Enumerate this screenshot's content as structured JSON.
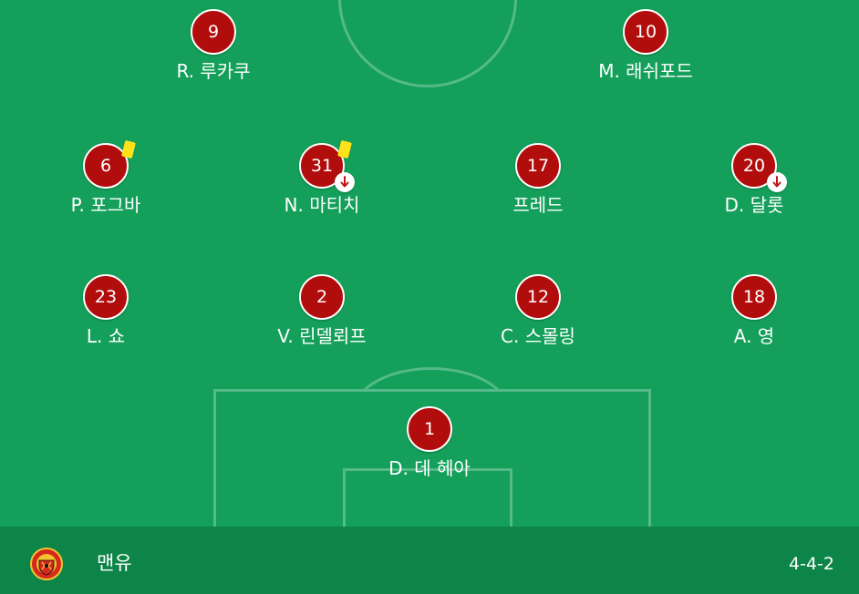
{
  "team": {
    "name": "맨유",
    "formation": "4-4-2",
    "crest_icon": "manchester-united-crest",
    "shirt_color": "#b20d0d",
    "pitch_color": "#14a05a",
    "footer_color": "#0e8548"
  },
  "players": [
    {
      "number": "9",
      "name": "R. 루카쿠",
      "yellow_card": false,
      "substituted": false
    },
    {
      "number": "10",
      "name": "M. 래쉬포드",
      "yellow_card": false,
      "substituted": false
    },
    {
      "number": "6",
      "name": "P. 포그바",
      "yellow_card": true,
      "substituted": false
    },
    {
      "number": "31",
      "name": "N. 마티치",
      "yellow_card": true,
      "substituted": true
    },
    {
      "number": "17",
      "name": "프레드",
      "yellow_card": false,
      "substituted": false
    },
    {
      "number": "20",
      "name": "D. 달롯",
      "yellow_card": false,
      "substituted": true
    },
    {
      "number": "23",
      "name": "L. 쇼",
      "yellow_card": false,
      "substituted": false
    },
    {
      "number": "2",
      "name": "V. 린델뢰프",
      "yellow_card": false,
      "substituted": false
    },
    {
      "number": "12",
      "name": "C. 스몰링",
      "yellow_card": false,
      "substituted": false
    },
    {
      "number": "18",
      "name": "A. 영",
      "yellow_card": false,
      "substituted": false
    },
    {
      "number": "1",
      "name": "D. 데 헤아",
      "yellow_card": false,
      "substituted": false
    }
  ]
}
